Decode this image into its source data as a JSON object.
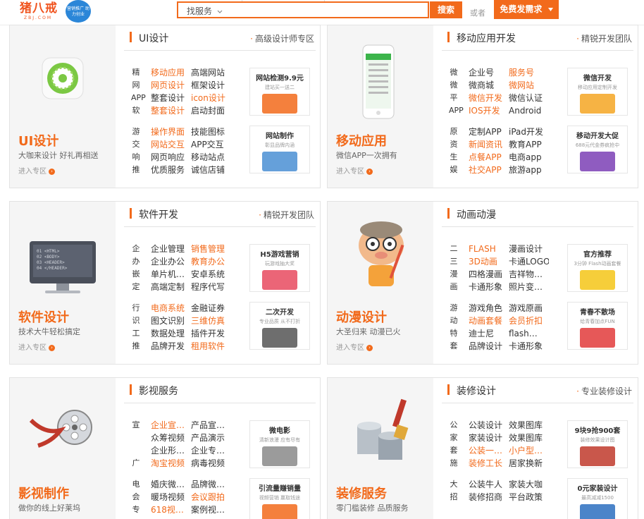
{
  "header": {
    "logo": "猪八戒",
    "logo_sub": "ZBJ.COM",
    "badge": "营销推广 助力创业",
    "search_dropdown": "找服务",
    "search_button": "搜索",
    "or_text": "或者",
    "post_button": "免费发需求"
  },
  "cards": [
    {
      "banner_title": "UI设计",
      "banner_desc": "大咖来设计 好礼再相送",
      "enter": "进入专区",
      "title": "UI设计",
      "more": "高级设计师专区",
      "groups": [
        {
          "label": [
            "精",
            "网",
            "APP",
            "软"
          ],
          "rows": [
            [
              "移动应用",
              "高端网站"
            ],
            [
              "网页设计",
              "框架设计"
            ],
            [
              "整套设计",
              "icon设计"
            ],
            [
              "整套设计",
              "启动封面"
            ]
          ],
          "hl": [
            [
              1,
              0
            ],
            [
              1,
              0
            ],
            [
              0,
              1
            ],
            [
              1,
              0
            ]
          ]
        },
        {
          "label": [
            "游",
            "交",
            "响",
            "推"
          ],
          "rows": [
            [
              "操作界面",
              "技能图标"
            ],
            [
              "网站交互",
              "APP交互"
            ],
            [
              "网页响应",
              "移动站点"
            ],
            [
              "优质服务",
              "诚信店铺"
            ]
          ],
          "hl": [
            [
              1,
              0
            ],
            [
              1,
              0
            ],
            [
              0,
              0
            ],
            [
              0,
              0
            ]
          ]
        }
      ],
      "promos": [
        {
          "title": "网站检测9.9元",
          "sub": "建站买一送二",
          "color": "#f26a1b"
        },
        {
          "title": "网站制作",
          "sub": "彰显品牌内涵",
          "color": "#4a8fd4"
        }
      ]
    },
    {
      "banner_title": "移动应用",
      "banner_desc": "微信APP一次拥有",
      "enter": "进入专区",
      "title": "移动应用开发",
      "more": "精锐开发团队",
      "groups": [
        {
          "label": [
            "微",
            "微",
            "平",
            "APP"
          ],
          "rows": [
            [
              "企业号",
              "服务号"
            ],
            [
              "微商城",
              "微网站"
            ],
            [
              "微信开发",
              "微信认证"
            ],
            [
              "IOS开发",
              "Android"
            ]
          ],
          "hl": [
            [
              0,
              1
            ],
            [
              0,
              1
            ],
            [
              1,
              0
            ],
            [
              1,
              0
            ]
          ]
        },
        {
          "label": [
            "原",
            "资",
            "生",
            "娱"
          ],
          "rows": [
            [
              "定制APP",
              "iPad开发"
            ],
            [
              "新闻资讯",
              "教育APP"
            ],
            [
              "点餐APP",
              "电商app"
            ],
            [
              "社交APP",
              "旅游app"
            ]
          ],
          "hl": [
            [
              0,
              0
            ],
            [
              1,
              0
            ],
            [
              1,
              0
            ],
            [
              1,
              0
            ]
          ]
        }
      ],
      "promos": [
        {
          "title": "微信开发",
          "sub": "移动应用定制开发",
          "color": "#f5a623"
        },
        {
          "title": "移动开发大促",
          "sub": "688元代金券疯抢中",
          "color": "#7b3fb5"
        }
      ]
    },
    {
      "banner_title": "软件设计",
      "banner_desc": "技术大牛轻松搞定",
      "enter": "进入专区",
      "title": "软件开发",
      "more": "精锐开发团队",
      "groups": [
        {
          "label": [
            "企",
            "办",
            "嵌",
            "定"
          ],
          "rows": [
            [
              "企业管理",
              "销售管理"
            ],
            [
              "企业办公",
              "教育办公"
            ],
            [
              "单片机…",
              "安卓系统"
            ],
            [
              "高端定制",
              "程序代写"
            ]
          ],
          "hl": [
            [
              0,
              1
            ],
            [
              0,
              1
            ],
            [
              0,
              0
            ],
            [
              0,
              0
            ]
          ]
        },
        {
          "label": [
            "行",
            "识",
            "工",
            "推"
          ],
          "rows": [
            [
              "电商系统",
              "金融证券"
            ],
            [
              "图文识别",
              "三维仿真"
            ],
            [
              "数据处理",
              "插件开发"
            ],
            [
              "品牌开发",
              "租用软件"
            ]
          ],
          "hl": [
            [
              1,
              0
            ],
            [
              0,
              1
            ],
            [
              0,
              0
            ],
            [
              0,
              1
            ]
          ]
        }
      ],
      "promos": [
        {
          "title": "H5游戏营销",
          "sub": "玩游戏抽大奖",
          "color": "#e84a5f"
        },
        {
          "title": "二次开发",
          "sub": "专业品质 从不打折",
          "color": "#555555"
        }
      ]
    },
    {
      "banner_title": "动漫设计",
      "banner_desc": "大圣归来 动漫已火",
      "enter": "进入专区",
      "title": "动画动漫",
      "more": "",
      "groups": [
        {
          "label": [
            "二",
            "三",
            "漫",
            "画"
          ],
          "rows": [
            [
              "FLASH",
              "漫画设计"
            ],
            [
              "3D动画",
              "卡通LOGO"
            ],
            [
              "四格漫画",
              "吉祥物…"
            ],
            [
              "卡通形象",
              "照片变…"
            ]
          ],
          "hl": [
            [
              1,
              0
            ],
            [
              1,
              0
            ],
            [
              0,
              0
            ],
            [
              0,
              0
            ]
          ]
        },
        {
          "label": [
            "游",
            "动",
            "特",
            "套"
          ],
          "rows": [
            [
              "游戏角色",
              "游戏原画"
            ],
            [
              "动画套餐",
              "会员折扣"
            ],
            [
              "迪士尼",
              "flash…"
            ],
            [
              "品牌设计",
              "卡通形象"
            ]
          ],
          "hl": [
            [
              0,
              0
            ],
            [
              1,
              1
            ],
            [
              0,
              0
            ],
            [
              0,
              0
            ]
          ]
        }
      ],
      "promos": [
        {
          "title": "官方推荐",
          "sub": "3分钟 Flash动画套餐",
          "color": "#f5c518"
        },
        {
          "title": "青春不散场",
          "sub": "给青春加点FUN",
          "color": "#e23b3b"
        }
      ]
    },
    {
      "banner_title": "影视制作",
      "banner_desc": "做你的线上好莱坞",
      "enter": "进入专区",
      "title": "影视服务",
      "more": "",
      "groups": [
        {
          "label": [
            "宣",
            "",
            "",
            "广"
          ],
          "rows": [
            [
              "企业宣…",
              "产品宣…"
            ],
            [
              "众筹视频",
              "产品演示"
            ],
            [
              "企业形…",
              "企业专…"
            ],
            [
              "淘宝视频",
              "病毒视频"
            ]
          ],
          "hl": [
            [
              1,
              0
            ],
            [
              0,
              0
            ],
            [
              0,
              0
            ],
            [
              1,
              0
            ]
          ]
        },
        {
          "label": [
            "电",
            "会",
            "专"
          ],
          "rows": [
            [
              "婚庆微…",
              "品牌微…"
            ],
            [
              "暖场视频",
              "会议跟拍"
            ],
            [
              "618视…",
              "案例视…"
            ]
          ],
          "hl": [
            [
              0,
              0
            ],
            [
              0,
              1
            ],
            [
              1,
              0
            ]
          ]
        }
      ],
      "promos": [
        {
          "title": "微电影",
          "sub": "清新浪漫 应有尽有",
          "color": "#8a8a8a"
        },
        {
          "title": "引流量赚销量",
          "sub": "视频营销 赢取钱途",
          "color": "#f26a1b"
        }
      ]
    },
    {
      "banner_title": "装修服务",
      "banner_desc": "零门槛装修 品质服务",
      "enter": "进入专区",
      "title": "装修设计",
      "more": "专业装修设计",
      "groups": [
        {
          "label": [
            "公",
            "家",
            "套",
            "施"
          ],
          "rows": [
            [
              "公装设计",
              "效果图库"
            ],
            [
              "家装设计",
              "效果图库"
            ],
            [
              "公装一…",
              "小户型…"
            ],
            [
              "装修工长",
              "居家换新"
            ]
          ],
          "hl": [
            [
              0,
              0
            ],
            [
              0,
              0
            ],
            [
              1,
              1
            ],
            [
              1,
              0
            ]
          ]
        },
        {
          "label": [
            "大",
            "招"
          ],
          "rows": [
            [
              "公装牛人",
              "家装大咖"
            ],
            [
              "装修招商",
              "平台政策"
            ]
          ],
          "hl": [
            [
              0,
              0
            ],
            [
              0,
              0
            ]
          ]
        }
      ],
      "promos": [
        {
          "title": "9块9抢900套",
          "sub": "装修效果设计图",
          "color": "#c0392b"
        },
        {
          "title": "0元家装设计",
          "sub": "最高减减1500",
          "color": "#2c6fbf"
        }
      ]
    }
  ]
}
